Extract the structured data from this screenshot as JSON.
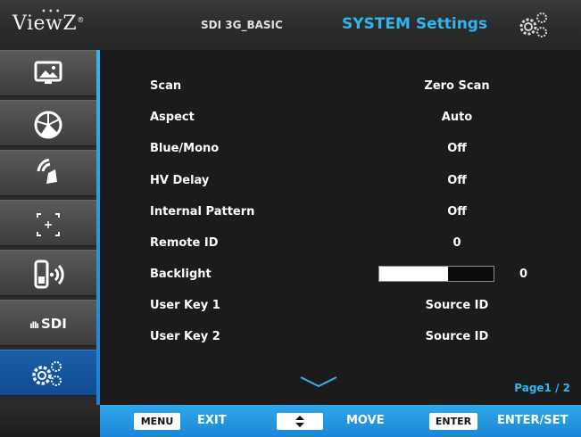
{
  "header": {
    "logo": "ViewZ",
    "source_name": "SDI 3G_BASIC",
    "title": "SYSTEM Settings",
    "icon": "gear-pair-icon"
  },
  "sidebar": {
    "items": [
      {
        "icon": "picture-monitor-icon"
      },
      {
        "icon": "color-wheel-icon"
      },
      {
        "icon": "audio-speaker-icon"
      },
      {
        "icon": "marker-crosshair-icon"
      },
      {
        "icon": "remote-signal-icon"
      },
      {
        "icon": "sdi-levels-icon",
        "label": "SDI"
      },
      {
        "icon": "system-gear-icon",
        "active": true
      }
    ]
  },
  "settings": [
    {
      "label": "Scan",
      "value": "Zero Scan"
    },
    {
      "label": "Aspect",
      "value": "Auto"
    },
    {
      "label": "Blue/Mono",
      "value": "Off"
    },
    {
      "label": "HV Delay",
      "value": "Off"
    },
    {
      "label": "Internal Pattern",
      "value": "Off"
    },
    {
      "label": "Remote ID",
      "value": "0"
    },
    {
      "label": "Backlight",
      "value": "0",
      "level": 0.6
    },
    {
      "label": "User Key 1",
      "value": "Source ID"
    },
    {
      "label": "User Key 2",
      "value": "Source ID"
    }
  ],
  "page_indicator": "Page1 / 2",
  "footer": {
    "keys": [
      {
        "key": "MENU",
        "action": "EXIT"
      },
      {
        "key": "up-down-arrow-icon",
        "action": "MOVE"
      },
      {
        "key": "ENTER",
        "action": "ENTER/SET"
      }
    ]
  },
  "colors": {
    "accent": "#2fb6f0",
    "sidebar_active": "#1559a0",
    "footer_accent": "#2ea9ea"
  }
}
